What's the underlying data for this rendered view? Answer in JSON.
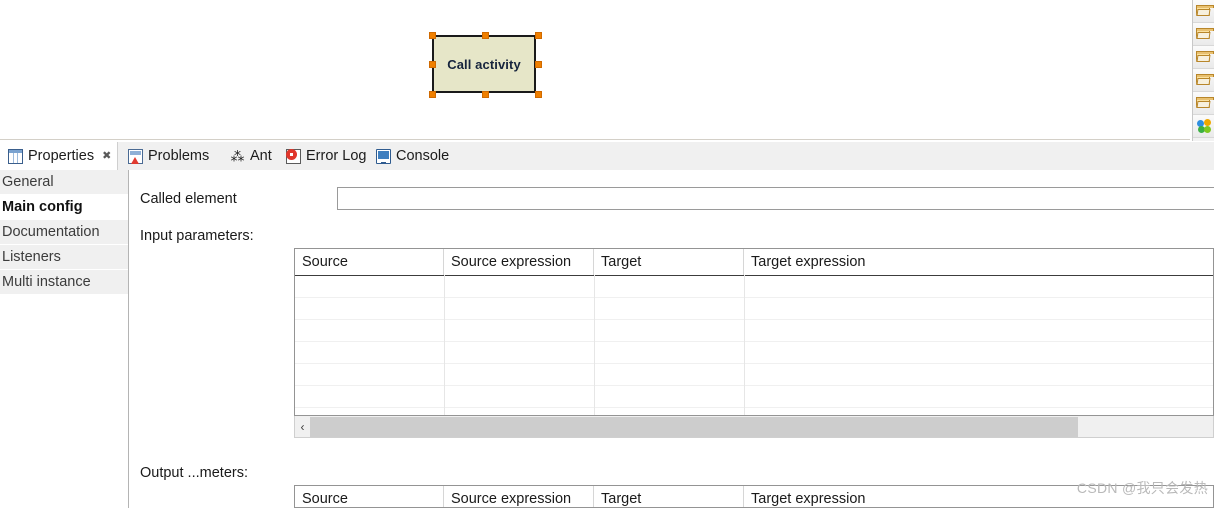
{
  "canvas": {
    "shape": {
      "label": "Call activity",
      "fill": "#e6e6c8",
      "stroke": "#1a1a1a",
      "handle_color": "#f08000",
      "selected": true
    },
    "palette": {
      "items": [
        {
          "icon": "folder-icon",
          "label": ""
        },
        {
          "icon": "folder-icon",
          "label": ""
        },
        {
          "icon": "folder-icon",
          "label": ""
        },
        {
          "icon": "folder-icon",
          "label": ""
        },
        {
          "icon": "folder-icon",
          "label": ""
        },
        {
          "icon": "flower-icon",
          "label": ""
        }
      ]
    }
  },
  "tabbar": {
    "tabs": [
      {
        "label": "Properties",
        "icon": "properties-icon",
        "active": true,
        "closable": true,
        "close_glyph": "✖"
      },
      {
        "label": "Problems",
        "icon": "problems-icon",
        "active": false,
        "closable": false
      },
      {
        "label": "Ant",
        "icon": "ant-icon",
        "active": false,
        "closable": false,
        "glyph": "⁂"
      },
      {
        "label": "Error Log",
        "icon": "error-log-icon",
        "active": false,
        "closable": false
      },
      {
        "label": "Console",
        "icon": "console-icon",
        "active": false,
        "closable": false
      }
    ]
  },
  "sidebar": {
    "items": [
      {
        "label": "General",
        "selected": false
      },
      {
        "label": "Main config",
        "selected": true
      },
      {
        "label": "Documentation",
        "selected": false
      },
      {
        "label": "Listeners",
        "selected": false
      },
      {
        "label": "Multi instance",
        "selected": false
      }
    ]
  },
  "main": {
    "called_element": {
      "label": "Called element",
      "value": "",
      "placeholder": ""
    },
    "input_parameters": {
      "label": "Input parameters:",
      "columns": [
        "Source",
        "Source expression",
        "Target",
        "Target expression"
      ],
      "rows": [],
      "empty_row_count": 6,
      "scrollbar": {
        "left_arrow_glyph": "‹",
        "thumb_fraction": 85
      }
    },
    "output_parameters": {
      "label": "Output ...meters:",
      "columns": [
        "Source",
        "Source expression",
        "Target",
        "Target expression"
      ],
      "rows": []
    }
  },
  "watermark": {
    "text": "CSDN @我只会发热"
  }
}
